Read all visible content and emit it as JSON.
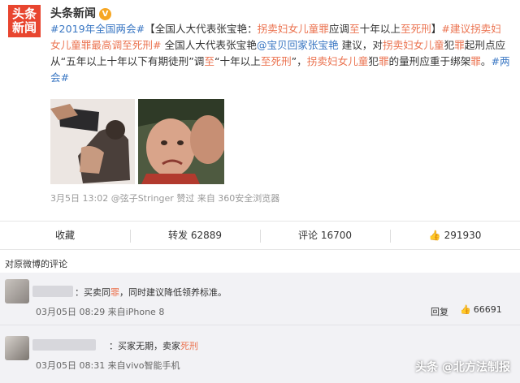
{
  "post": {
    "logo_line1": "头条",
    "logo_line2": "新闻",
    "author": "头条新闻",
    "verified_badge": "V",
    "text": {
      "s1": "#2019年全国两会#",
      "s2": "【全国人大代表张宝艳：",
      "s3": "拐卖妇女儿童罪",
      "s4": "应调",
      "s5": "至",
      "s6": "十年以上",
      "s7": "至死刑",
      "s8": "】",
      "s9": "#建议拐卖妇女儿童罪最高调至死刑#",
      "s10": " 全国人大代表张宝艳",
      "s11": "@宝贝回家张宝艳",
      "s12": " 建议，对",
      "s13": "拐卖妇女儿童",
      "s14": "犯",
      "s15": "罪",
      "s16": "起刑点应从“五年以上十年以下有期徒刑”调",
      "s17": "至",
      "s18": "“十年以上",
      "s19": "至死刑",
      "s20": "”，",
      "s21": "拐卖妇女儿童",
      "s22": "犯",
      "s23": "罪",
      "s24": "的量刑应重于绑架",
      "s25": "罪",
      "s26": "。",
      "s27": "#两会#"
    },
    "meta_time": "3月5日 13:02",
    "meta_rest": "@弦子Stringer 赞过  来自 360安全浏览器"
  },
  "actions": {
    "favorite": "收藏",
    "repost_label": "转发",
    "repost_count": "62889",
    "comment_label": "评论",
    "comment_count": "16700",
    "like_count": "291930"
  },
  "comments_header": "对原微博的评论",
  "comments": [
    {
      "text_pre": "：买卖同",
      "text_hl": "罪",
      "text_post": "，同时建议降低领养标准。",
      "time": "03月05日 08:29 来自iPhone 8",
      "reply": "回复",
      "likes": "66691"
    },
    {
      "text_pre": "：买家无期，卖家",
      "text_hl": "死刑",
      "text_post": "",
      "time": "03月05日 08:31 来自vivo智能手机"
    }
  ],
  "watermark": "头条 @北方法制报",
  "colors": {
    "accent": "#eb7350",
    "link": "#3a77c3",
    "logo_bg": "#e8452f",
    "badge": "#f6a623"
  }
}
